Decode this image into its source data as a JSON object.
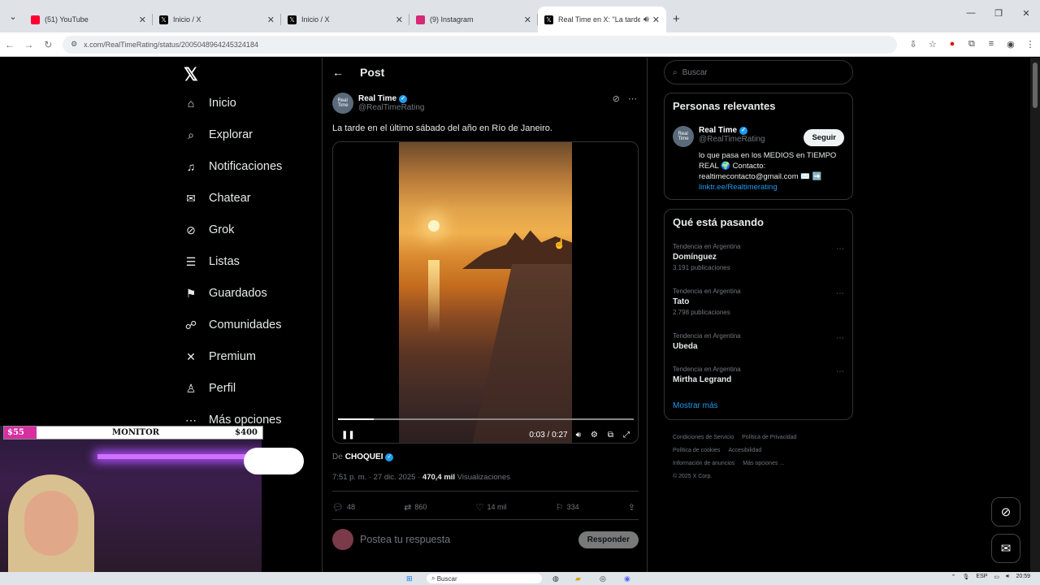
{
  "browser": {
    "tabs": [
      {
        "title": "(51) YouTube",
        "icon": "youtube-icon",
        "color": "#ff0033"
      },
      {
        "title": "Inicio / X",
        "icon": "x-icon",
        "color": "#000000"
      },
      {
        "title": "Inicio / X",
        "icon": "x-icon",
        "color": "#000000"
      },
      {
        "title": "(9) Instagram",
        "icon": "instagram-icon",
        "color": "#d62976"
      },
      {
        "title": "Real Time en X: \"La tarde en",
        "icon": "x-icon",
        "color": "#000000",
        "active": true
      }
    ],
    "url": "x.com/RealTimeRating/status/2005048964245324184"
  },
  "nav": {
    "items": [
      {
        "label": "Inicio",
        "icon": "home-icon",
        "glyph": "⌂"
      },
      {
        "label": "Explorar",
        "icon": "search-icon",
        "glyph": "⌕"
      },
      {
        "label": "Notificaciones",
        "icon": "bell-icon",
        "glyph": "♫"
      },
      {
        "label": "Chatear",
        "icon": "mail-icon",
        "glyph": "✉"
      },
      {
        "label": "Grok",
        "icon": "grok-icon",
        "glyph": "⊘"
      },
      {
        "label": "Listas",
        "icon": "list-icon",
        "glyph": "☰"
      },
      {
        "label": "Guardados",
        "icon": "bookmark-icon",
        "glyph": "⚑"
      },
      {
        "label": "Comunidades",
        "icon": "communities-icon",
        "glyph": "☍"
      },
      {
        "label": "Premium",
        "icon": "x-premium-icon",
        "glyph": "✕"
      },
      {
        "label": "Perfil",
        "icon": "profile-icon",
        "glyph": "♙"
      },
      {
        "label": "Más opciones",
        "icon": "more-icon",
        "glyph": "⋯"
      }
    ]
  },
  "post": {
    "header": "Post",
    "author": {
      "name": "Real Time",
      "handle": "@RealTimeRating"
    },
    "text": "La tarde en el último sábado del año en Río de Janeiro.",
    "video": {
      "time": "0:03 / 0:27",
      "progress": 0.12
    },
    "source_prefix": "De",
    "source": "CHOQUEI",
    "timestamp": "7:51 p. m. · 27 dic. 2025 · ",
    "views_count": "470,4 mil",
    "views_label": " Visualizaciones",
    "stats": {
      "replies": "48",
      "reposts": "860",
      "likes": "14 mil",
      "bookmarks": "334"
    },
    "reply_placeholder": "Postea tu respuesta",
    "reply_button": "Responder"
  },
  "sidebar": {
    "search_placeholder": "Buscar",
    "relevant_title": "Personas relevantes",
    "relevant": {
      "name": "Real Time",
      "handle": "@RealTimeRating",
      "follow": "Seguir",
      "bio": "lo que pasa en los MEDIOS en TIEMPO REAL 🌍 Contacto: realtimecontacto@gmail.com ✉️ ➡️",
      "link": "linktr.ee/Realtimerating"
    },
    "trends_title": "Qué está pasando",
    "trends": [
      {
        "context": "Tendencia en Argentina",
        "name": "Domínguez",
        "count": "3.191 publicaciones"
      },
      {
        "context": "Tendencia en Argentina",
        "name": "Tato",
        "count": "2.798 publicaciones"
      },
      {
        "context": "Tendencia en Argentina",
        "name": "Ubeda",
        "count": ""
      },
      {
        "context": "Tendencia en Argentina",
        "name": "Mirtha Legrand",
        "count": ""
      }
    ],
    "show_more": "Mostrar más",
    "footer": [
      "Condiciones de Servicio",
      "Política de Privacidad",
      "Política de cookies",
      "Accesibilidad",
      "Información de anuncios",
      "Más opciones ...",
      "© 2025 X Corp."
    ]
  },
  "overlay": {
    "left": "$55",
    "title": "MONITOR",
    "right": "$400"
  },
  "taskbar": {
    "search": "Buscar",
    "lang": "ESP",
    "time": "20:59"
  }
}
